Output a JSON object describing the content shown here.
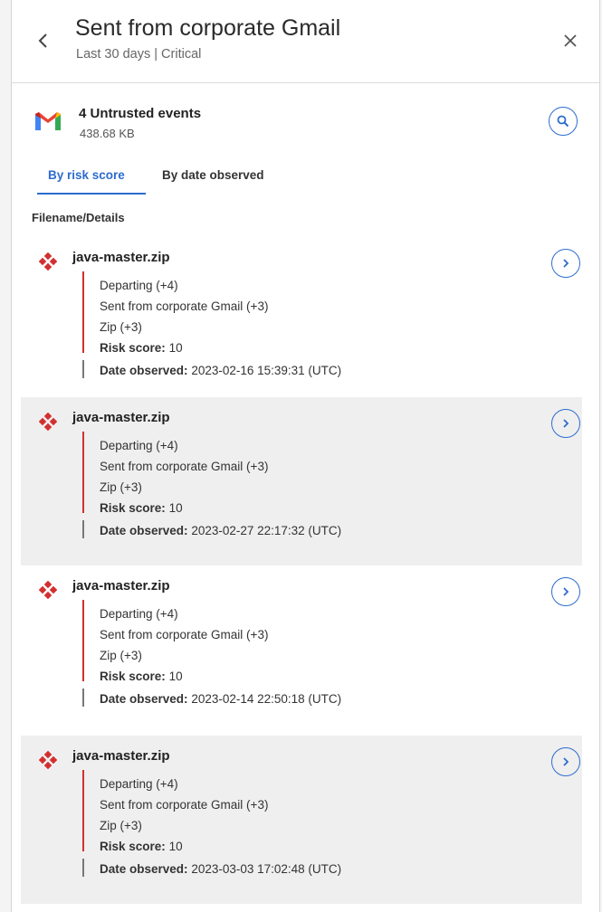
{
  "header": {
    "title": "Sent from corporate Gmail",
    "subtitle": "Last 30 days | Critical"
  },
  "summary": {
    "events_title": "4 Untrusted events",
    "events_size": "438.68 KB",
    "icon": "gmail-icon"
  },
  "tabs": [
    {
      "label": "By risk score",
      "active": true
    },
    {
      "label": "By date observed",
      "active": false
    }
  ],
  "column_header": "Filename/Details",
  "risk_score_label": "Risk score:",
  "date_label": "Date observed:",
  "events": [
    {
      "filename": "java-master.zip",
      "details": [
        "Departing (+4)",
        "Sent from corporate Gmail (+3)",
        "Zip (+3)"
      ],
      "risk_score": "10",
      "date_observed": "2023-02-16 15:39:31 (UTC)"
    },
    {
      "filename": "java-master.zip",
      "details": [
        "Departing (+4)",
        "Sent from corporate Gmail (+3)",
        "Zip (+3)"
      ],
      "risk_score": "10",
      "date_observed": "2023-02-27 22:17:32 (UTC)"
    },
    {
      "filename": "java-master.zip",
      "details": [
        "Departing (+4)",
        "Sent from corporate Gmail (+3)",
        "Zip (+3)"
      ],
      "risk_score": "10",
      "date_observed": "2023-02-14 22:50:18 (UTC)"
    },
    {
      "filename": "java-master.zip",
      "details": [
        "Departing (+4)",
        "Sent from corporate Gmail (+3)",
        "Zip (+3)"
      ],
      "risk_score": "10",
      "date_observed": "2023-03-03 17:02:48 (UTC)"
    }
  ],
  "colors": {
    "accent": "#2d6ccf",
    "risk_red": "#d32f2f",
    "shaded_row": "#efefef"
  }
}
